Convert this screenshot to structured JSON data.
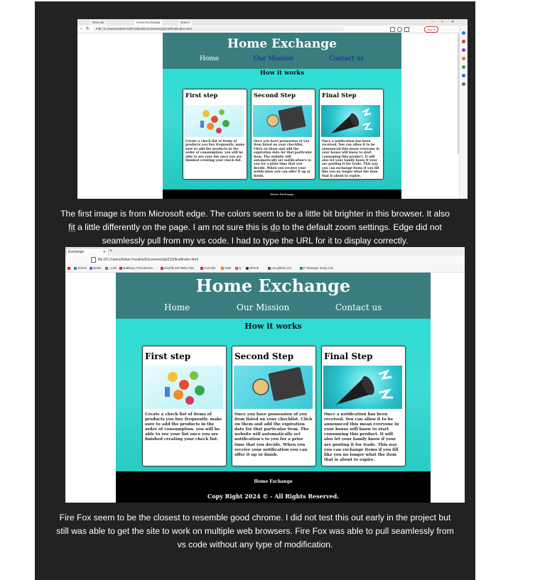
{
  "screenshot1": {
    "tabs": [
      "New tab",
      "Home Exchange",
      "NotAA"
    ],
    "window_controls": [
      "–",
      "□",
      "✕"
    ],
    "address": "File  |  C:/Users/Adam%20Fosdick/Documents/git215/final/index.html",
    "sync_badge": "Sign in",
    "site": {
      "title": "Home Exchange",
      "nav": [
        "Home",
        "Our Mission",
        "Contact us"
      ],
      "how_it_works": "How it works",
      "footer": "Home Exchange"
    }
  },
  "caption1": {
    "line1": "The first image is from Microsoft edge. The colors seem to be a little bit brighter in this browser.  It also",
    "fit": "fit",
    "line2_a": " a little differently on the page. I am not sure this is ",
    "do": "do",
    "line2_b": " to the default zoom settings. Edge did not",
    "line3": "seamlessly pull from my vs code. I had to type the URL for it to display correctly."
  },
  "screenshot2": {
    "tab": "Exchange",
    "tab_close": "✕",
    "new_tab": "+",
    "address": "file:///C:/Users/Adam Fosdick/Documents/git215/final/index.html",
    "bookmarks": [
      "School",
      "Media",
      "_code",
      "Mathway | Precalculus...",
      "simplify sell Maker-har...",
      "YouTube",
      "replit",
      "ry",
      "GitHub",
      "css.github.com",
      "FI Manager Setup Cal..."
    ],
    "site": {
      "title": "Home Exchange",
      "nav": [
        "Home",
        "Our Mission",
        "Contact us"
      ],
      "how_it_works": "How it works",
      "footer_title": "Home Exchange",
      "footer_copy": "Copy Right 2024 © - All Rights Reserved."
    }
  },
  "cards": [
    {
      "title": "First step",
      "text": "Create a check list of items of products you buy frequently. make sure to add the products in the order of consumption. you will be able to see your list once you are finished creating your check list."
    },
    {
      "title": "Second Step",
      "text": "Once you have possession of you item listed on your checklist. Click on them and add the expiration date for that particular item. The website will automatically set notification's to you for a prior time that you decide. When you receive your notification you can offer it up or finish."
    },
    {
      "title": "Final Step",
      "text": "Once a notification has been received. You can allow it to be announced this mean everyone in your house will know to start consuming this product. It will also let your family know if your are posting it for trade. This way you can exchange items if you fill like you no longer what the item that is about to expire."
    }
  ],
  "caption2": {
    "line1": "Fire Fox seem to be the closest to resemble good chrome.  I did not test this out early in the project but",
    "line2": "still was able to get the site to work on multiple web browsers. Fire Fox was able to pull seamlessly from",
    "line3": "vs code without any type of modification."
  },
  "colors": {
    "document_bg": "#222222",
    "site_header": "#3a7d7f",
    "site_teal": "#24dcd5",
    "nav_link_blue": "#1a1aa8",
    "footer_bg": "#000000"
  }
}
